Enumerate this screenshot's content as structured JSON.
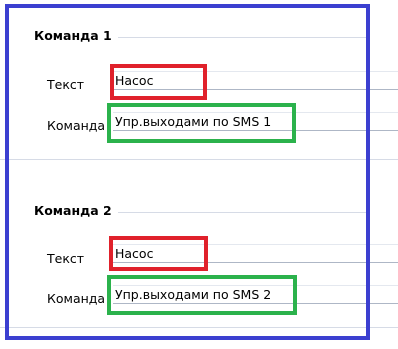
{
  "commands": [
    {
      "title": "Команда 1",
      "text_label": "Текст",
      "text_value": "Насос",
      "command_label": "Команда",
      "command_value": "Упр.выходами по SMS 1"
    },
    {
      "title": "Команда 2",
      "text_label": "Текст",
      "text_value": "Насос",
      "command_label": "Команда",
      "command_value": "Упр.выходами по SMS 2"
    }
  ],
  "colors": {
    "frame": "#3b3fd0",
    "text_highlight": "#e0212b",
    "command_highlight": "#2bb24c"
  }
}
